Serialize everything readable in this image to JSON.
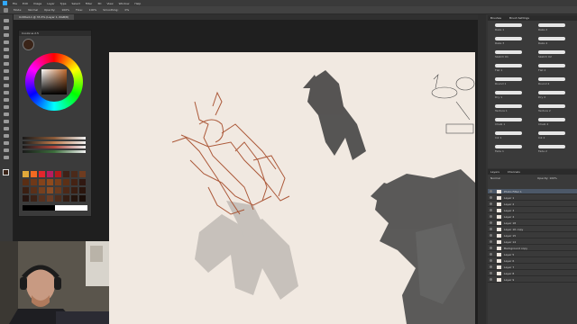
{
  "app": {
    "menu": [
      "File",
      "Edit",
      "Image",
      "Layer",
      "Type",
      "Select",
      "Filter",
      "3D",
      "View",
      "Window",
      "Help"
    ],
    "options": {
      "mode_label": "Mode:",
      "mode_value": "Normal",
      "opacity_label": "Opacity:",
      "opacity_value": "100%",
      "flow_label": "Flow:",
      "flow_value": "100%",
      "smoothing_label": "Smoothing:",
      "smoothing_value": "0%"
    },
    "document_tab": "Untitled-1 @ 33.3% (Layer 1, RGB/8)"
  },
  "color_panel": {
    "title": "Coolorus 2.5",
    "current_color": "#3a2418",
    "palette": [
      [
        "#e2a93a",
        "#f26a21",
        "#e3262c",
        "#b81d5f",
        "#b31b1b",
        "#3e2117",
        "#4b2a1a",
        "#6e3b1f"
      ],
      [
        "#5a2e14",
        "#6f3818",
        "#84431b",
        "#8f4a1c",
        "#7a3f1a",
        "#5d3016",
        "#452314",
        "#301811"
      ],
      [
        "#3a1f12",
        "#5b3019",
        "#76401f",
        "#8a4c24",
        "#6a3a1e",
        "#4d2817",
        "#3a1e12",
        "#2a150d"
      ],
      [
        "#271510",
        "#3d2216",
        "#57311f",
        "#6a3c25",
        "#4d2c1c",
        "#341d13",
        "#24140d",
        "#1a0e09"
      ]
    ],
    "slider_colors": [
      "#8b5a38",
      "#c07a4a",
      "#b0453a",
      "#3c6e3c"
    ]
  },
  "brush_panel": {
    "title": "Brushes",
    "tab2": "Brush Settings",
    "items": [
      "Rake 1",
      "Rake 2",
      "Rake 3",
      "Rake 4",
      "Sketch 01",
      "Sketch 02",
      "Flat 1",
      "Flat 2",
      "Round 1",
      "Round 2",
      "Dry 1",
      "Dry 2",
      "Texture 1",
      "Texture 2",
      "Chalk 1",
      "Chalk 2",
      "Ink 1",
      "Ink 2",
      "Fade 1",
      "Fade 2"
    ]
  },
  "layers_panel": {
    "title": "Layers",
    "tab2": "Channels",
    "blend_mode": "Normal",
    "opacity_label": "Opacity:",
    "opacity_value": "100%",
    "layers": [
      "Photo Filter 1",
      "Layer 1",
      "Layer 2",
      "Layer 3",
      "Layer 4",
      "Layer 18",
      "Layer 16 copy",
      "Layer 15",
      "Layer 14",
      "Background copy",
      "Layer 5",
      "Layer 6",
      "Layer 7",
      "Layer 8",
      "Layer 9"
    ]
  },
  "colors": {
    "sketch_brown": "#a54a28",
    "sketch_grey": "#4a4a4a",
    "canvas_bg": "#f1e9e1"
  }
}
